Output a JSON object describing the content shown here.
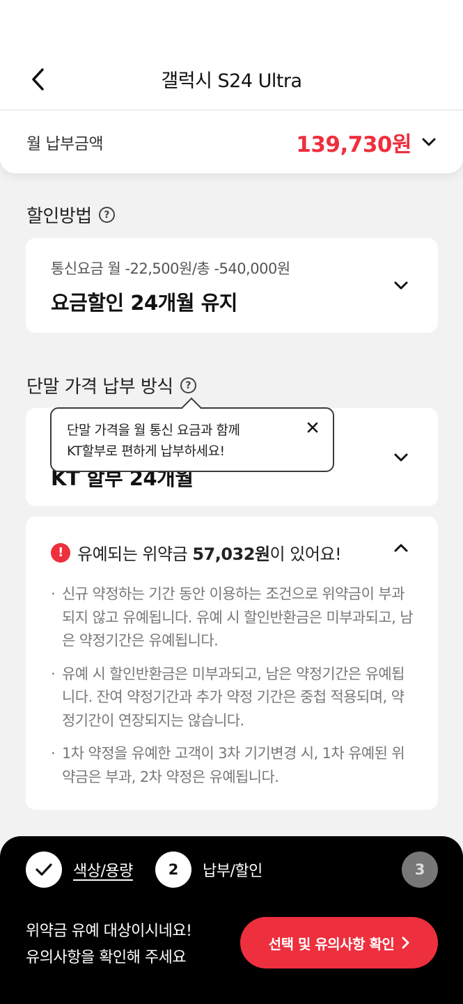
{
  "header": {
    "title": "갤럭시 S24 Ultra",
    "back_icon": "chevron-left-icon"
  },
  "payment": {
    "label": "월 납부금액",
    "amount": "139,730원"
  },
  "discount": {
    "section_title": "할인방법",
    "sub": "통신요금 월 -22,500원/총 -540,000원",
    "main": "요금할인 24개월 유지"
  },
  "installment": {
    "section_title": "단말 가격 납부 방식",
    "main": "KT 할부 24개월",
    "tooltip": "단말 가격을 월 통신 요금과 함께\nKT할부로 편하게 납부하세요!"
  },
  "penalty": {
    "prefix": "유예되는 위약금 ",
    "amount": "57,032원",
    "suffix": "이 있어요!",
    "notes": [
      "신규 약정하는 기간 동안 이용하는 조건으로 위약금이 부과되지 않고 유예됩니다. 유예 시 할인반환금은 미부과되고, 남은 약정기간은 유예됩니다.",
      "유예 시 할인반환금은 미부과되고, 남은 약정기간은 유예됩니다. 잔여 약정기간과 추가 약정 기간은 중첩 적용되며, 약정기간이 연장되지는 않습니다.",
      "1차 약정을 유예한 고객이 3차 기기변경 시, 1차 유예된 위약금은 부과, 2차 약정은 유예됩니다."
    ]
  },
  "steps": [
    {
      "label": "색상/용량",
      "state": "done"
    },
    {
      "number": "2",
      "label": "납부/할인",
      "state": "current"
    },
    {
      "number": "3",
      "state": "upcoming"
    }
  ],
  "bottom": {
    "message_line1": "위약금 유예 대상이시네요!",
    "message_line2": "유의사항을 확인해 주세요",
    "cta_label": "선택 및 유의사항 확인"
  },
  "colors": {
    "accent": "#ee2f3d",
    "panel": "#000000",
    "background": "#f2f2f2"
  }
}
